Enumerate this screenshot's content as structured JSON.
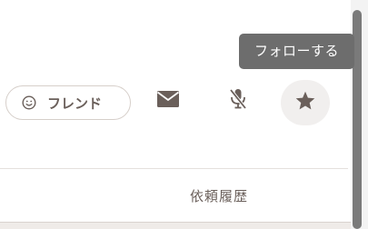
{
  "tooltip": {
    "text": "フォローする"
  },
  "actions": {
    "friend_label": "フレンド",
    "mail_icon": "mail-icon",
    "mic_icon": "mic-off-icon",
    "star_icon": "star-icon",
    "smiley_icon": "smiley-icon"
  },
  "tabs": {
    "history_label": "依頼履歴"
  },
  "colors": {
    "icon": "#6a5f5a",
    "tooltip_bg": "#6d6d6d",
    "button_border": "#d6cfca",
    "star_bg": "#f1efee"
  }
}
